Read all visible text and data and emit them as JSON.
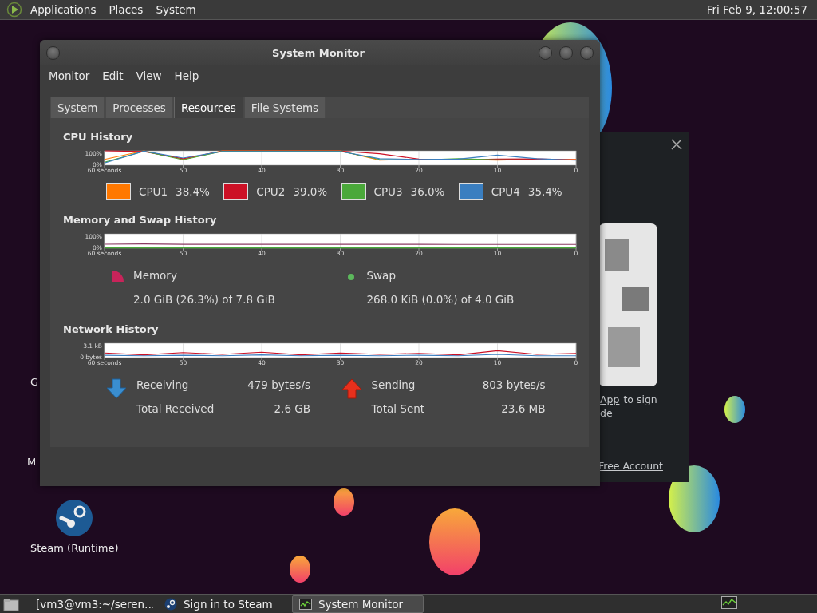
{
  "top_panel": {
    "menus": [
      "Applications",
      "Places",
      "System"
    ],
    "clock": "Fri Feb  9, 12:00:57"
  },
  "desktop_icons": [
    {
      "label": "G",
      "kind": "hidden"
    },
    {
      "label": "M",
      "kind": "hidden"
    },
    {
      "label": "Steam (Runtime)",
      "kind": "steam"
    }
  ],
  "steam_window": {
    "link": "App",
    "text": "to sign",
    "line_2": "de",
    "account_link": "Free Account"
  },
  "system_monitor": {
    "title": "System Monitor",
    "menu": [
      "Monitor",
      "Edit",
      "View",
      "Help"
    ],
    "tabs": [
      {
        "label": "System",
        "selected": false
      },
      {
        "label": "Processes",
        "selected": false
      },
      {
        "label": "Resources",
        "selected": true
      },
      {
        "label": "File Systems",
        "selected": false
      }
    ],
    "cpu": {
      "heading": "CPU History",
      "graph": {
        "kind": "cpu",
        "y_labels": [
          "100%",
          "0%"
        ],
        "x_labels": [
          "60 seconds",
          "50",
          "40",
          "30",
          "20",
          "10",
          "0"
        ]
      },
      "cpus": [
        {
          "name": "CPU1",
          "value": "38.4%",
          "color": "#ff7800"
        },
        {
          "name": "CPU2",
          "value": "39.0%",
          "color": "#cc1126"
        },
        {
          "name": "CPU3",
          "value": "36.0%",
          "color": "#4aa83a"
        },
        {
          "name": "CPU4",
          "value": "35.4%",
          "color": "#3a7ec0"
        }
      ]
    },
    "memory": {
      "heading": "Memory and Swap History",
      "graph": {
        "kind": "memory",
        "y_labels": [
          "100%",
          "0%"
        ],
        "x_labels": [
          "60 seconds",
          "50",
          "40",
          "30",
          "20",
          "10",
          "0"
        ]
      },
      "items": [
        {
          "name": "Memory",
          "value": "2.0 GiB (26.3%) of 7.8 GiB",
          "color": "#c8245a",
          "kind": "pie"
        },
        {
          "name": "Swap",
          "value": "268.0 KiB (0.0%) of 4.0 GiB",
          "color": "#5cb85c",
          "kind": "dot"
        }
      ]
    },
    "network": {
      "heading": "Network History",
      "graph": {
        "kind": "network",
        "y_labels": [
          "3.1 kB",
          "0 bytes"
        ],
        "x_labels": [
          "60 seconds",
          "50",
          "40",
          "30",
          "20",
          "10",
          "0"
        ]
      },
      "stats": [
        {
          "kind": "receiving",
          "label": "Receiving",
          "rate": "479 bytes/s",
          "total_label": "Total Received",
          "total": "2.6 GB"
        },
        {
          "kind": "sending",
          "label": "Sending",
          "rate": "803 bytes/s",
          "total_label": "Total Sent",
          "total": "23.6 MB"
        }
      ]
    }
  },
  "taskbar": {
    "items": [
      {
        "label": "[vm3@vm3:~/seren…",
        "kind": "terminal",
        "selected": false
      },
      {
        "label": "Sign in to Steam",
        "kind": "steam",
        "selected": false
      },
      {
        "label": "System Monitor",
        "kind": "monitor",
        "selected": true
      }
    ]
  }
}
